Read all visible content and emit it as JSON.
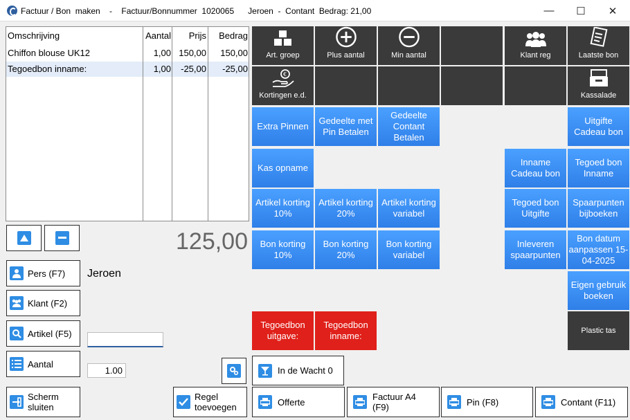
{
  "window": {
    "title": "Factuur / Bon  maken    -    Factuur/Bonnummer  1020065      Jeroen  -  Contant  Bedrag: 21,00",
    "minimize": "—",
    "maximize": "☐",
    "close": "✕"
  },
  "grid": {
    "columns": [
      "Omschrijving",
      "Aantal",
      "Prijs",
      "Bedrag"
    ],
    "rows": [
      {
        "omschrijving": "Chiffon blouse UK12",
        "aantal": "1,00",
        "prijs": "150,00",
        "bedrag": "150,00"
      },
      {
        "omschrijving": "Tegoedbon inname:",
        "aantal": "1,00",
        "prijs": "-25,00",
        "bedrag": "-25,00"
      }
    ]
  },
  "total": "125,00",
  "left": {
    "pers": "Pers (F7)",
    "pers_value": "Jeroen",
    "klant": "Klant (F2)",
    "artikel": "Artikel (F5)",
    "artikel_value": "",
    "aantal": "Aantal",
    "aantal_value": "1.00",
    "scherm_sluiten": "Scherm sluiten",
    "regel_toevoegen": "Regel toevoegen"
  },
  "tiles": {
    "art_groep": "Art. groep",
    "plus_aantal": "Plus aantal",
    "min_aantal": "Min aantal",
    "klant_reg": "Klant reg",
    "laatste_bon": "Laatste bon",
    "kortingen": "Kortingen e.d.",
    "kassalade": "Kassalade",
    "extra_pinnen": "Extra Pinnen",
    "gedeelte_pin": "Gedeelte met Pin Betalen",
    "gedeelte_contant": "Gedeelte Contant Betalen",
    "uitgifte_cadeau": "Uitgifte Cadeau bon",
    "kas_opname": "Kas opname",
    "inname_cadeau": "Inname Cadeau bon",
    "tegoed_inname": "Tegoed bon Inname",
    "artikel_10": "Artikel korting 10%",
    "artikel_20": "Artikel korting 20%",
    "artikel_var": "Artikel korting variabel",
    "tegoed_uitgifte": "Tegoed bon Uitgifte",
    "spaarpunten_bij": "Spaarpunten bijboeken",
    "bon_10": "Bon korting 10%",
    "bon_20": "Bon korting 20%",
    "bon_var": "Bon korting variabel",
    "inleveren_spaar": "Inleveren spaarpunten",
    "bon_datum": "Bon datum aanpassen 15-04-2025",
    "eigen_gebruik": "Eigen gebruik boeken",
    "tegoedbon_uitgave": "Tegoedbon uitgave:",
    "tegoedbon_inname": "Tegoedbon inname:",
    "plastic_tas": "Plastic tas"
  },
  "bottom": {
    "in_de_wacht": "In de Wacht 0",
    "offerte": "Offerte",
    "factuur": "Factuur A4 (F9)",
    "pin": "Pin (F8)",
    "contant": "Contant (F11)"
  },
  "colors": {
    "accent": "#2f8de4",
    "tile_blue": "#3a8ff5",
    "tile_dark": "#3a3a3a",
    "tile_red": "#e0201a"
  }
}
